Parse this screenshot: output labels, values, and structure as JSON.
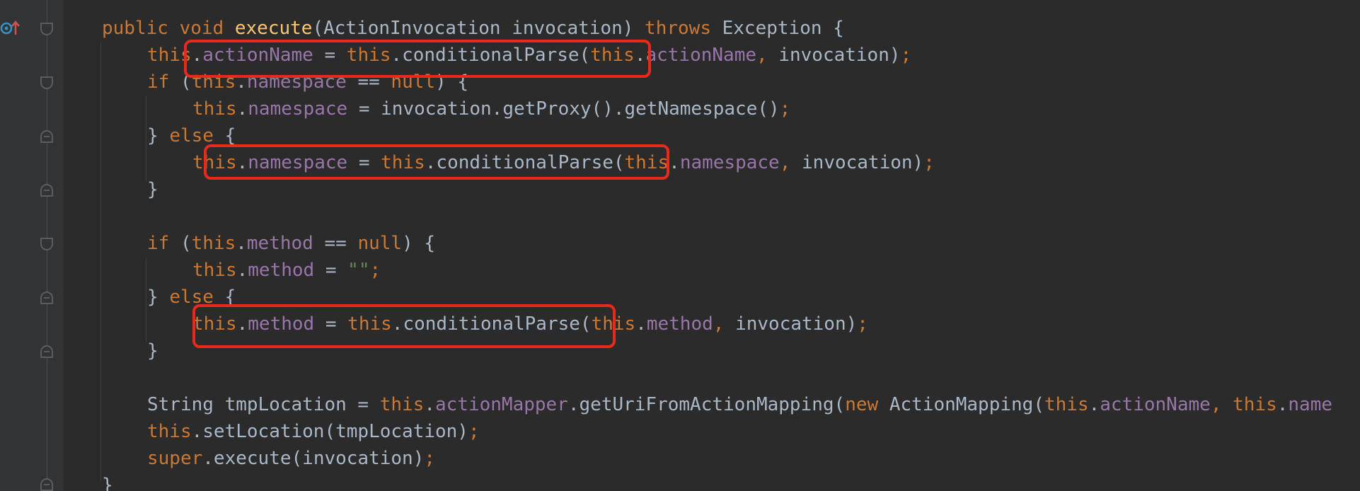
{
  "editor": {
    "theme_colors": {
      "background": "#2b2b2b",
      "keyword": "#cc7832",
      "method": "#ffc66d",
      "field": "#9876aa",
      "string": "#6a8759",
      "text": "#a9b7c6",
      "highlight": "#e8291c"
    },
    "gutter_icon": "override-method-icon",
    "lines": [
      {
        "tokens": [
          [
            "kw",
            "public"
          ],
          [
            "plain",
            " "
          ],
          [
            "kw",
            "void"
          ],
          [
            "plain",
            " "
          ],
          [
            "fn",
            "execute"
          ],
          [
            "plain",
            "(ActionInvocation invocation) "
          ],
          [
            "kw",
            "throws"
          ],
          [
            "plain",
            " Exception {"
          ]
        ]
      },
      {
        "tokens": [
          [
            "kw",
            "this"
          ],
          [
            "plain",
            "."
          ],
          [
            "fld",
            "actionName"
          ],
          [
            "plain",
            " = "
          ],
          [
            "kw",
            "this"
          ],
          [
            "plain",
            ".conditionalParse("
          ],
          [
            "kw",
            "this"
          ],
          [
            "plain",
            "."
          ],
          [
            "fld",
            "actionName"
          ],
          [
            "kw",
            ","
          ],
          [
            "plain",
            " invocation)"
          ],
          [
            "kw",
            ";"
          ]
        ]
      },
      {
        "tokens": [
          [
            "kw",
            "if"
          ],
          [
            "plain",
            " ("
          ],
          [
            "kw",
            "this"
          ],
          [
            "plain",
            "."
          ],
          [
            "fld",
            "namespace"
          ],
          [
            "plain",
            " == "
          ],
          [
            "kw",
            "null"
          ],
          [
            "plain",
            ") {"
          ]
        ]
      },
      {
        "tokens": [
          [
            "kw",
            "this"
          ],
          [
            "plain",
            "."
          ],
          [
            "fld",
            "namespace"
          ],
          [
            "plain",
            " = invocation.getProxy().getNamespace()"
          ],
          [
            "kw",
            ";"
          ]
        ]
      },
      {
        "tokens": [
          [
            "plain",
            "} "
          ],
          [
            "kw",
            "else"
          ],
          [
            "plain",
            " {"
          ]
        ]
      },
      {
        "tokens": [
          [
            "kw",
            "this"
          ],
          [
            "plain",
            "."
          ],
          [
            "fld",
            "namespace"
          ],
          [
            "plain",
            " = "
          ],
          [
            "kw",
            "this"
          ],
          [
            "plain",
            ".conditionalParse("
          ],
          [
            "kw",
            "this"
          ],
          [
            "plain",
            "."
          ],
          [
            "fld",
            "namespace"
          ],
          [
            "kw",
            ","
          ],
          [
            "plain",
            " invocation)"
          ],
          [
            "kw",
            ";"
          ]
        ]
      },
      {
        "tokens": [
          [
            "plain",
            "}"
          ]
        ]
      },
      {
        "tokens": []
      },
      {
        "tokens": [
          [
            "kw",
            "if"
          ],
          [
            "plain",
            " ("
          ],
          [
            "kw",
            "this"
          ],
          [
            "plain",
            "."
          ],
          [
            "fld",
            "method"
          ],
          [
            "plain",
            " == "
          ],
          [
            "kw",
            "null"
          ],
          [
            "plain",
            ") {"
          ]
        ]
      },
      {
        "tokens": [
          [
            "kw",
            "this"
          ],
          [
            "plain",
            "."
          ],
          [
            "fld",
            "method"
          ],
          [
            "plain",
            " = "
          ],
          [
            "str",
            "\"\""
          ],
          [
            "kw",
            ";"
          ]
        ]
      },
      {
        "tokens": [
          [
            "plain",
            "} "
          ],
          [
            "kw",
            "else"
          ],
          [
            "plain",
            " {"
          ]
        ]
      },
      {
        "tokens": [
          [
            "kw",
            "this"
          ],
          [
            "plain",
            "."
          ],
          [
            "fld",
            "method"
          ],
          [
            "plain",
            " = "
          ],
          [
            "kw",
            "this"
          ],
          [
            "plain",
            ".conditionalParse("
          ],
          [
            "kw",
            "this"
          ],
          [
            "plain",
            "."
          ],
          [
            "fld",
            "method"
          ],
          [
            "kw",
            ","
          ],
          [
            "plain",
            " invocation)"
          ],
          [
            "kw",
            ";"
          ]
        ]
      },
      {
        "tokens": [
          [
            "plain",
            "}"
          ]
        ]
      },
      {
        "tokens": []
      },
      {
        "tokens": [
          [
            "plain",
            "String tmpLocation = "
          ],
          [
            "kw",
            "this"
          ],
          [
            "plain",
            "."
          ],
          [
            "fld",
            "actionMapper"
          ],
          [
            "plain",
            ".getUriFromActionMapping("
          ],
          [
            "kw",
            "new"
          ],
          [
            "plain",
            " ActionMapping("
          ],
          [
            "kw",
            "this"
          ],
          [
            "plain",
            "."
          ],
          [
            "fld",
            "actionName"
          ],
          [
            "kw",
            ","
          ],
          [
            "plain",
            " "
          ],
          [
            "kw",
            "this"
          ],
          [
            "plain",
            "."
          ],
          [
            "fld",
            "name"
          ]
        ]
      },
      {
        "tokens": [
          [
            "kw",
            "this"
          ],
          [
            "plain",
            ".setLocation(tmpLocation)"
          ],
          [
            "kw",
            ";"
          ]
        ]
      },
      {
        "tokens": [
          [
            "kw",
            "super"
          ],
          [
            "plain",
            ".execute(invocation)"
          ],
          [
            "kw",
            ";"
          ]
        ]
      },
      {
        "tokens": [
          [
            "plain",
            "}"
          ]
        ]
      }
    ]
  }
}
